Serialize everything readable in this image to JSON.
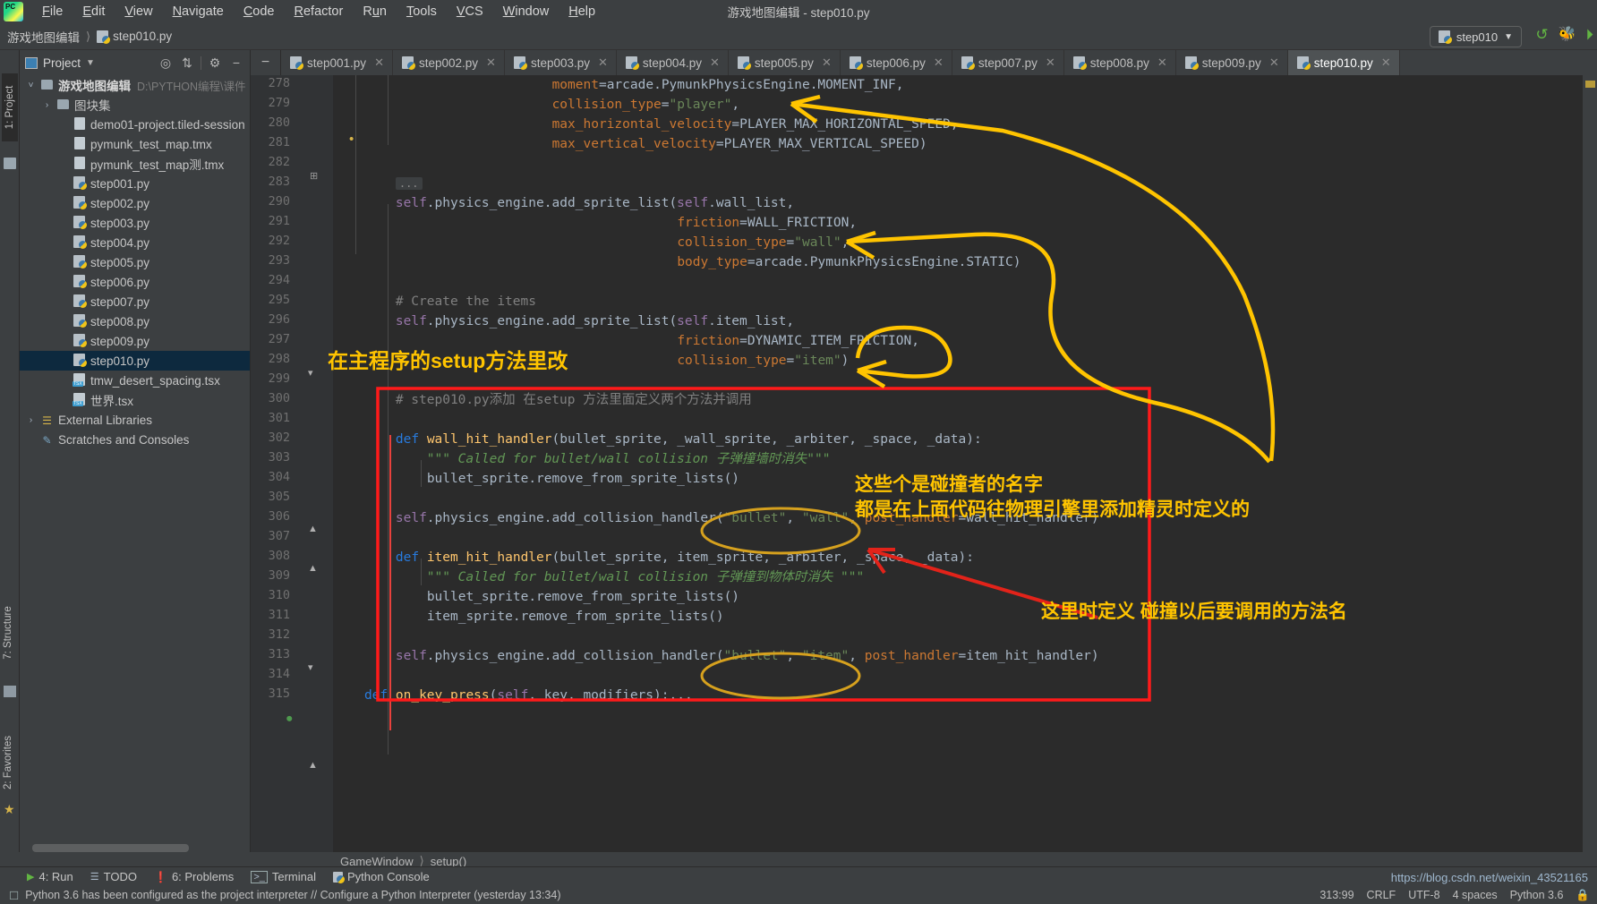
{
  "window": {
    "title": "游戏地图编辑 - step010.py"
  },
  "menubar": {
    "items": [
      {
        "label": "File",
        "mnemonic": "F"
      },
      {
        "label": "Edit",
        "mnemonic": "E"
      },
      {
        "label": "View",
        "mnemonic": "V"
      },
      {
        "label": "Navigate",
        "mnemonic": "N"
      },
      {
        "label": "Code",
        "mnemonic": "C"
      },
      {
        "label": "Refactor",
        "mnemonic": "R"
      },
      {
        "label": "Run",
        "mnemonic": "u"
      },
      {
        "label": "Tools",
        "mnemonic": "T"
      },
      {
        "label": "VCS",
        "mnemonic": "V"
      },
      {
        "label": "Window",
        "mnemonic": "W"
      },
      {
        "label": "Help",
        "mnemonic": "H"
      }
    ]
  },
  "navbar": {
    "crumbs": [
      "游戏地图编辑",
      "step010.py"
    ],
    "run_config": "step010",
    "run_icons": [
      "rerun-icon",
      "debug-icon",
      "run-with-coverage-icon"
    ]
  },
  "left_strip": {
    "project_tab": "1: Project",
    "structure_tab": "7: Structure",
    "favorites_tab": "2: Favorites"
  },
  "project_panel": {
    "title": "Project",
    "toolbar_icons": [
      "locate-icon",
      "collapse-all-icon",
      "settings-gear-icon",
      "hide-icon"
    ],
    "tree": [
      {
        "indent": 0,
        "arrow": "v",
        "icon": "folder",
        "label": "游戏地图编辑",
        "dim": "D:\\PYTHON编程\\课件",
        "bold": true
      },
      {
        "indent": 1,
        "arrow": ">",
        "icon": "folder",
        "label": "图块集",
        "dim": "",
        "bold": false
      },
      {
        "indent": 2,
        "arrow": "",
        "icon": "file",
        "label": "demo01-project.tiled-session",
        "dim": "",
        "bold": false
      },
      {
        "indent": 2,
        "arrow": "",
        "icon": "file",
        "label": "pymunk_test_map.tmx",
        "dim": "",
        "bold": false
      },
      {
        "indent": 2,
        "arrow": "",
        "icon": "file",
        "label": "pymunk_test_map测.tmx",
        "dim": "",
        "bold": false
      },
      {
        "indent": 2,
        "arrow": "",
        "icon": "py",
        "label": "step001.py",
        "dim": "",
        "bold": false
      },
      {
        "indent": 2,
        "arrow": "",
        "icon": "py",
        "label": "step002.py",
        "dim": "",
        "bold": false
      },
      {
        "indent": 2,
        "arrow": "",
        "icon": "py",
        "label": "step003.py",
        "dim": "",
        "bold": false
      },
      {
        "indent": 2,
        "arrow": "",
        "icon": "py",
        "label": "step004.py",
        "dim": "",
        "bold": false
      },
      {
        "indent": 2,
        "arrow": "",
        "icon": "py",
        "label": "step005.py",
        "dim": "",
        "bold": false
      },
      {
        "indent": 2,
        "arrow": "",
        "icon": "py",
        "label": "step006.py",
        "dim": "",
        "bold": false
      },
      {
        "indent": 2,
        "arrow": "",
        "icon": "py",
        "label": "step007.py",
        "dim": "",
        "bold": false
      },
      {
        "indent": 2,
        "arrow": "",
        "icon": "py",
        "label": "step008.py",
        "dim": "",
        "bold": false
      },
      {
        "indent": 2,
        "arrow": "",
        "icon": "py",
        "label": "step009.py",
        "dim": "",
        "bold": false
      },
      {
        "indent": 2,
        "arrow": "",
        "icon": "py",
        "label": "step010.py",
        "dim": "",
        "bold": false,
        "selected": true
      },
      {
        "indent": 2,
        "arrow": "",
        "icon": "tsx",
        "label": "tmw_desert_spacing.tsx",
        "dim": "",
        "bold": false
      },
      {
        "indent": 2,
        "arrow": "",
        "icon": "tsx",
        "label": "世界.tsx",
        "dim": "",
        "bold": false
      },
      {
        "indent": 0,
        "arrow": ">",
        "icon": "lib",
        "label": "External Libraries",
        "dim": "",
        "bold": false
      },
      {
        "indent": 0,
        "arrow": "",
        "icon": "scratch",
        "label": "Scratches and Consoles",
        "dim": "",
        "bold": false
      }
    ]
  },
  "editor_tabs": [
    {
      "label": "step001.py",
      "active": false
    },
    {
      "label": "step002.py",
      "active": false
    },
    {
      "label": "step003.py",
      "active": false
    },
    {
      "label": "step004.py",
      "active": false
    },
    {
      "label": "step005.py",
      "active": false
    },
    {
      "label": "step006.py",
      "active": false
    },
    {
      "label": "step007.py",
      "active": false
    },
    {
      "label": "step008.py",
      "active": false
    },
    {
      "label": "step009.py",
      "active": false
    },
    {
      "label": "step010.py",
      "active": true
    }
  ],
  "editor": {
    "line_numbers": [
      "278",
      "279",
      "280",
      "281",
      "282",
      "283",
      "290",
      "291",
      "292",
      "293",
      "294",
      "295",
      "296",
      "297",
      "298",
      "299",
      "300",
      "301",
      "302",
      "303",
      "304",
      "305",
      "306",
      "307",
      "308",
      "309",
      "310",
      "311",
      "312",
      "313",
      "314",
      "315"
    ],
    "code_lines": [
      "                            moment=arcade.PymunkPhysicsEngine.MOMENT_INF,",
      "                            collision_type=\"player\",",
      "                            max_horizontal_velocity=PLAYER_MAX_HORIZONTAL_SPEED,",
      "                            max_vertical_velocity=PLAYER_MAX_VERTICAL_SPEED)",
      "",
      "        ...",
      "        self.physics_engine.add_sprite_list(self.wall_list,",
      "                                            friction=WALL_FRICTION,",
      "                                            collision_type=\"wall\",",
      "                                            body_type=arcade.PymunkPhysicsEngine.STATIC)",
      "",
      "        # Create the items",
      "        self.physics_engine.add_sprite_list(self.item_list,",
      "                                            friction=DYNAMIC_ITEM_FRICTION,",
      "                                            collision_type=\"item\")",
      "",
      "        # step010.py添加 在setup 方法里面定义两个方法并调用",
      "",
      "        def wall_hit_handler(bullet_sprite, _wall_sprite, _arbiter, _space, _data):",
      "            \"\"\" Called for bullet/wall collision 子弹撞墙时消失\"\"\"",
      "            bullet_sprite.remove_from_sprite_lists()",
      "",
      "        self.physics_engine.add_collision_handler(\"bullet\", \"wall\", post_handler=wall_hit_handler)",
      "",
      "        def item_hit_handler(bullet_sprite, item_sprite, _arbiter, _space, _data):",
      "            \"\"\" Called for bullet/wall collision 子弹撞到物体时消失 \"\"\"",
      "            bullet_sprite.remove_from_sprite_lists()",
      "            item_sprite.remove_from_sprite_lists()",
      "",
      "        self.physics_engine.add_collision_handler(\"bullet\", \"item\", post_handler=item_hit_handler)",
      "",
      "    def on_key_press(self, key, modifiers):..."
    ],
    "fold_placeholder": "...",
    "breadcrumb": [
      "GameWindow",
      "setup()"
    ]
  },
  "annotations": [
    {
      "id": "setup-note",
      "text": "在主程序的setup方法里改"
    },
    {
      "id": "collider-names-note-1",
      "text": "这些个是碰撞者的名字"
    },
    {
      "id": "collider-names-note-2",
      "text": "都是在上面代码往物理引擎里添加精灵时定义的"
    },
    {
      "id": "handler-name-note",
      "text": "这里时定义 碰撞以后要调用的方法名"
    }
  ],
  "bottom_tools": [
    {
      "label": "4: Run",
      "icon": "run-icon",
      "mnemonic": "4"
    },
    {
      "label": "TODO",
      "icon": "todo-icon",
      "mnemonic": ""
    },
    {
      "label": "6: Problems",
      "icon": "problems-icon",
      "mnemonic": "6"
    },
    {
      "label": "Terminal",
      "icon": "terminal-icon",
      "mnemonic": ""
    },
    {
      "label": "Python Console",
      "icon": "python-console-icon",
      "mnemonic": ""
    }
  ],
  "statusbar": {
    "message": "Python 3.6 has been configured as the project interpreter // Configure a Python Interpreter   (yesterday 13:34)",
    "caret": "313:99",
    "line_sep": "CRLF",
    "encoding": "UTF-8",
    "indent": "4 spaces",
    "interpreter": "Python 3.6"
  },
  "watermark_url": "https://blog.csdn.net/weixin_43521165",
  "colors": {
    "accent_red": "#ff1a1a",
    "accent_yellow": "#ffc400",
    "arrow_red": "#e2231a",
    "editor_bg": "#2b2b2b",
    "panel_bg": "#3c3f41"
  }
}
